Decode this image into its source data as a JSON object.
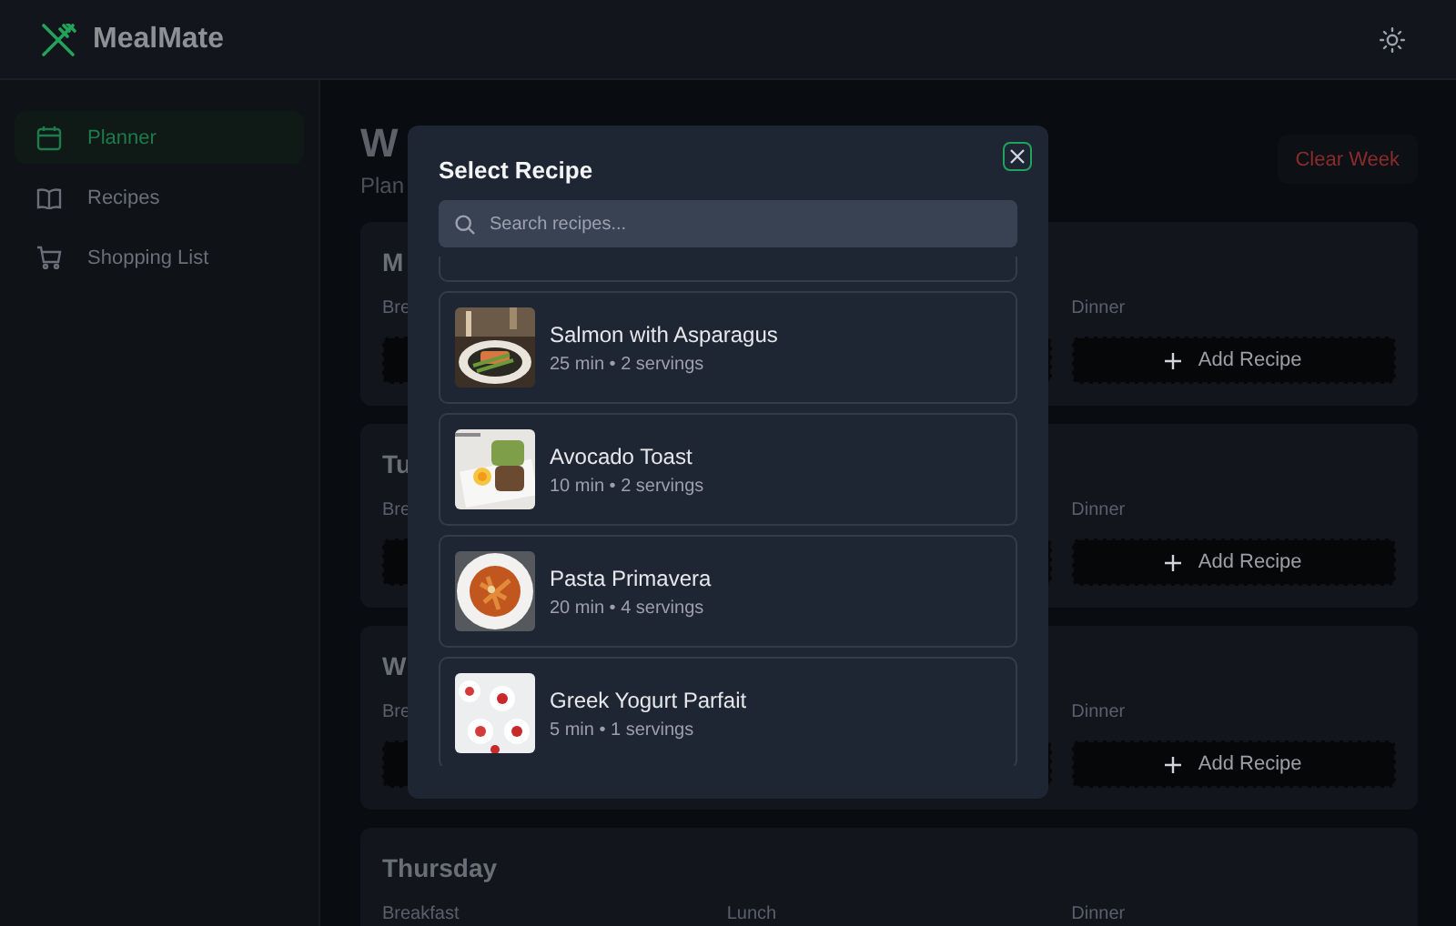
{
  "app": {
    "name": "MealMate"
  },
  "nav": [
    {
      "label": "Planner",
      "selected": true
    },
    {
      "label": "Recipes",
      "selected": false
    },
    {
      "label": "Shopping List",
      "selected": false
    }
  ],
  "page": {
    "title": "W",
    "subtitle": "Plan",
    "clear_button": "Clear Week"
  },
  "days": [
    {
      "name": "M",
      "slots": [
        {
          "label": "Bre",
          "kind": "button"
        },
        {
          "kind": "button"
        },
        {
          "label": "Dinner",
          "kind": "button",
          "button": "Add Recipe"
        }
      ]
    },
    {
      "name": "Tu",
      "slots": [
        {
          "label": "Bre",
          "kind": "button"
        },
        {
          "kind": "button"
        },
        {
          "label": "Dinner",
          "kind": "button",
          "button": "Add Recipe"
        }
      ]
    },
    {
      "name": "W",
      "slots": [
        {
          "label": "Bre",
          "kind": "button"
        },
        {
          "kind": "button"
        },
        {
          "label": "Dinner",
          "kind": "button",
          "button": "Add Recipe"
        }
      ]
    },
    {
      "name": "Thursday",
      "slots": [
        {
          "label": "Breakfast",
          "kind": "none"
        },
        {
          "label": "Lunch",
          "kind": "none"
        },
        {
          "label": "Dinner",
          "kind": "none"
        }
      ]
    }
  ],
  "modal": {
    "title": "Select Recipe",
    "search": {
      "placeholder": "Search recipes..."
    },
    "recipes": [
      {
        "kind": "cut"
      },
      {
        "kind": "full",
        "name": "Salmon with Asparagus",
        "meta": "25 min • 2 servings"
      },
      {
        "kind": "full",
        "name": "Avocado Toast",
        "meta": "10 min • 2 servings"
      },
      {
        "kind": "full",
        "name": "Pasta Primavera",
        "meta": "20 min • 4 servings"
      },
      {
        "kind": "full",
        "name": "Greek Yogurt Parfait",
        "meta": "5 min • 1 servings"
      }
    ]
  }
}
